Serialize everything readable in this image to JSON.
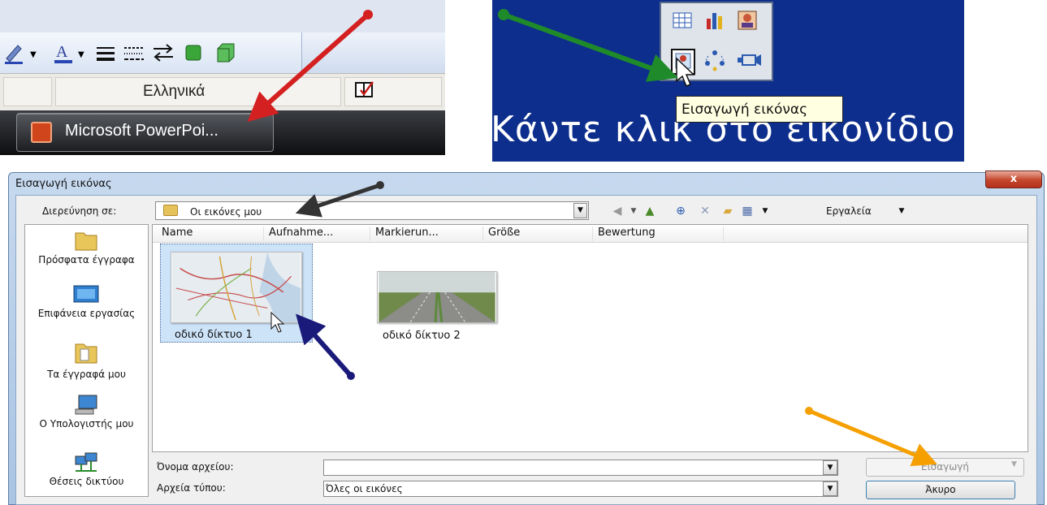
{
  "top_left": {
    "language": "Ελληνικά",
    "taskbar_label": "Microsoft PowerPoi...",
    "toolbar_icons": [
      "pen-color-icon",
      "font-color-icon",
      "line-style-icon",
      "dash-style-icon",
      "arrow-style-icon",
      "shadow-icon",
      "3d-icon"
    ]
  },
  "top_right": {
    "tooltip": "Εισαγωγή εικόνας",
    "placeholder_text": "Κάντε κλικ στο εικονίδιο",
    "content_icons": [
      "table-icon",
      "chart-icon",
      "org-chart-icon",
      "picture-icon",
      "diagram-icon",
      "media-clip-icon"
    ]
  },
  "dialog": {
    "title": "Εισαγωγή εικόνας",
    "close_label": "x",
    "look_in_label": "Διερεύνηση σε:",
    "look_in_value": "Οι εικόνες μου",
    "tools_label": "Εργαλεία",
    "places": [
      {
        "label": "Πρόσφατα έγγραφα",
        "icon": "recent-documents-icon"
      },
      {
        "label": "Επιφάνεια εργασίας",
        "icon": "desktop-icon"
      },
      {
        "label": "Τα έγγραφά μου",
        "icon": "my-documents-icon"
      },
      {
        "label": "Ο Υπολογιστής μου",
        "icon": "my-computer-icon"
      },
      {
        "label": "Θέσεις δικτύου",
        "icon": "network-places-icon"
      }
    ],
    "columns": [
      "Name",
      "Aufnahme...",
      "Markierun...",
      "Größe",
      "Bewertung"
    ],
    "files": [
      {
        "name": "οδικό δίκτυο 1",
        "selected": true
      },
      {
        "name": "οδικό δίκτυο 2",
        "selected": false
      }
    ],
    "filename_label": "Όνομα αρχείου:",
    "filename_value": "",
    "filetype_label": "Αρχεία τύπου:",
    "filetype_value": "Όλες οι εικόνες",
    "insert_label": "Εισαγωγή",
    "cancel_label": "Άκυρο"
  },
  "annotation_colors": {
    "red": "#d42020",
    "green": "#1f8a2a",
    "dark": "#333333",
    "blue": "#1a1a7a",
    "orange": "#f5a000"
  }
}
